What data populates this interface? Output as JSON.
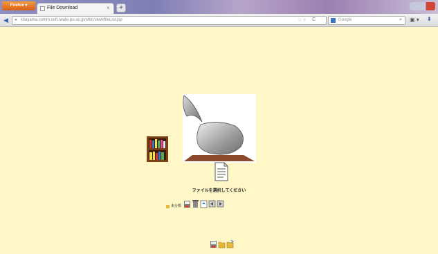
{
  "browser": {
    "menu_button": "Firefox ▾",
    "tab_title": "File Download",
    "tab_close": "×",
    "new_tab": "+",
    "url": "kitayama.comm.soft.iwate-pu.ac.jp/ofdc/view/fileList.jsp",
    "search_placeholder": "Google",
    "back_glyph": "◀",
    "star_glyph": "☆ ▿",
    "reload_glyph": "C",
    "search_go_glyph": "⌕",
    "bookmark_glyph": "▣ ▾",
    "download_glyph": "⬇"
  },
  "page": {
    "prompt": "ファイルを選択してください",
    "toolbar_label": "未分類"
  },
  "colors": {
    "background": "#fff7c8",
    "accent": "#3c74c8"
  }
}
